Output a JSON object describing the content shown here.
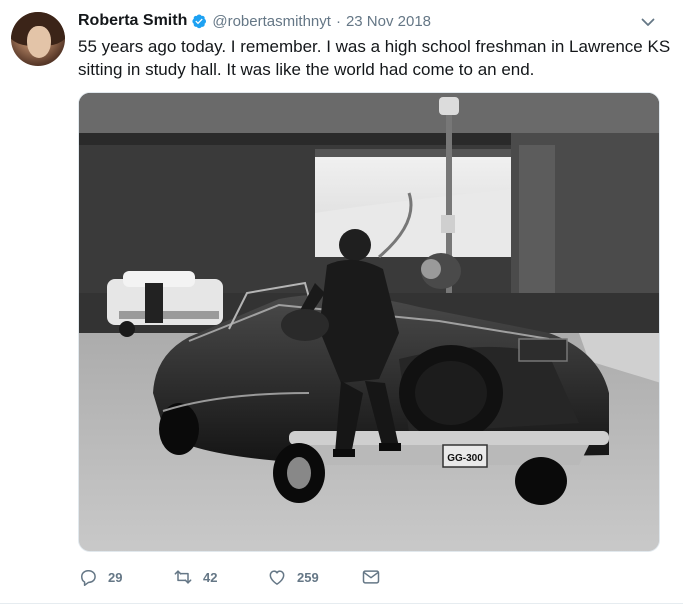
{
  "tweet": {
    "author": {
      "name": "Roberta Smith",
      "handle": "@robertasmithnyt",
      "verified": true
    },
    "separator": "·",
    "date": "23 Nov 2018",
    "text_lines": [
      "55 years ago today. I remember.  I was a high school freshman in Lawrence KS",
      "sitting in study hall. It was like the world had come to an end."
    ],
    "plate": "GG-300",
    "actions": {
      "replies": "29",
      "retweets": "42",
      "likes": "259"
    }
  },
  "colors": {
    "verified_blue": "#1da1f2",
    "muted_gray": "#657786",
    "text": "#14171a"
  },
  "icons": [
    "chevron-down-icon",
    "verified-badge-icon",
    "reply-icon",
    "retweet-icon",
    "like-icon",
    "direct-message-icon"
  ]
}
